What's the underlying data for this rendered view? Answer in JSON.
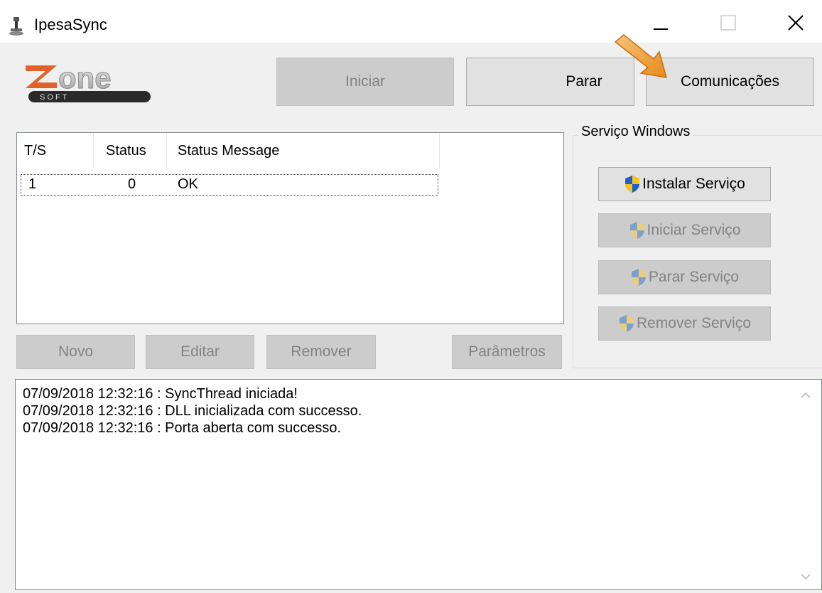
{
  "window": {
    "title": "IpesaSync",
    "icons": {
      "app": "ipesasync-icon",
      "minimize": "minimize-icon",
      "maximize": "maximize-icon",
      "close": "close-icon"
    }
  },
  "logo": {
    "text": "zone",
    "subtext": "S O F T",
    "icon": "zonesoft-logo"
  },
  "toolbar": {
    "iniciar": "Iniciar",
    "parar": "Parar",
    "comunicacoes": "Comunicações"
  },
  "list": {
    "columns": [
      "T/S",
      "Status",
      "Status Message"
    ],
    "rows": [
      {
        "ts": "1",
        "status": "0",
        "message": "OK"
      }
    ]
  },
  "actions": {
    "novo": "Novo",
    "editar": "Editar",
    "remover": "Remover",
    "parametros": "Parâmetros"
  },
  "service": {
    "group_label": "Serviço Windows",
    "instalar": "Instalar Serviço",
    "iniciar": "Iniciar Serviço",
    "parar": "Parar Serviço",
    "remover": "Remover Serviço",
    "icon": "uac-shield-icon"
  },
  "log": {
    "lines": [
      "07/09/2018 12:32:16 : SyncThread iniciada!",
      "07/09/2018 12:32:16 : DLL inicializada com successo.",
      "07/09/2018 12:32:16 : Porta aberta com successo."
    ]
  },
  "annotation": {
    "icon": "orange-arrow-icon",
    "color": "#f0a030"
  }
}
